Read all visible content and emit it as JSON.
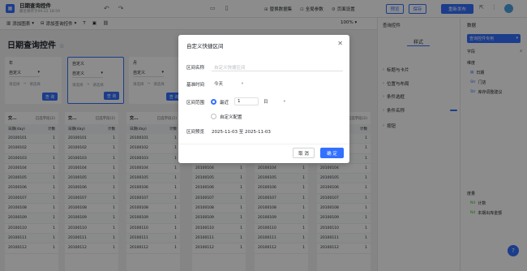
{
  "header": {
    "title": "日期查询控件",
    "subtitle": "最近保存于09-22 18:59",
    "actions": [
      "替换数据集",
      "全局参数",
      "页面设置"
    ],
    "preview": "预览",
    "save": "保存",
    "publish": "重新发布"
  },
  "toolbar": {
    "add_chart": "添加图表",
    "add_query": "添加查询控件",
    "zoom": "100%"
  },
  "canvas": {
    "page_title": "日期查询控件",
    "filters": [
      {
        "label": "年",
        "select": "自定义",
        "start": "请选择",
        "end": "请选择",
        "button": "查 询"
      },
      {
        "label": "自定义",
        "select": "自定义",
        "start": "请选择",
        "end": "请选择",
        "button": "查 询"
      },
      {
        "label": "月",
        "select": "自定义",
        "start": "请选择",
        "end": "请选择",
        "button": "查 询"
      }
    ],
    "table_header": {
      "title": "交...",
      "selected": "已选字段(2)"
    },
    "table_cols": [
      "日期(day)",
      "计数"
    ],
    "table_rows": [
      [
        "20100101",
        "1"
      ],
      [
        "20100102",
        "1"
      ],
      [
        "20100103",
        "1"
      ],
      [
        "20100104",
        "1"
      ],
      [
        "20100105",
        "1"
      ],
      [
        "20100106",
        "1"
      ],
      [
        "20100107",
        "1"
      ],
      [
        "20100108",
        "1"
      ],
      [
        "20100109",
        "1"
      ],
      [
        "20100110",
        "1"
      ],
      [
        "20100111",
        "1"
      ],
      [
        "20100112",
        "1"
      ]
    ]
  },
  "style_panel": {
    "title": "查询控件",
    "tab": "样式",
    "sections": [
      "标题与卡片",
      "位置与布局",
      "条件选框",
      "条件名称",
      "按钮"
    ]
  },
  "data_panel": {
    "title": "数据",
    "control_select": "查询控件专用",
    "fields_label": "字段",
    "dimension_label": "维度",
    "dimensions": [
      "日期",
      "门店",
      "库存调整建议"
    ],
    "measure_label": "度量",
    "measures": [
      "计数",
      "本期出库金额"
    ]
  },
  "modal": {
    "title": "自定义快捷区间",
    "name_label": "区间名称",
    "name_placeholder": "自定义快捷区间",
    "base_label": "基准时间",
    "base_value": "今天",
    "range_label": "区间范围",
    "recent_label": "最近",
    "recent_num": "1",
    "recent_unit": "日",
    "custom_label": "自定义配置",
    "preview_label": "区间预览",
    "preview_value": "2025-11-03 至 2025-11-03",
    "cancel": "取 消",
    "ok": "确 定"
  },
  "colors": {
    "accent": "#3370ff",
    "mask": "rgba(0,0,0,0.45)"
  }
}
